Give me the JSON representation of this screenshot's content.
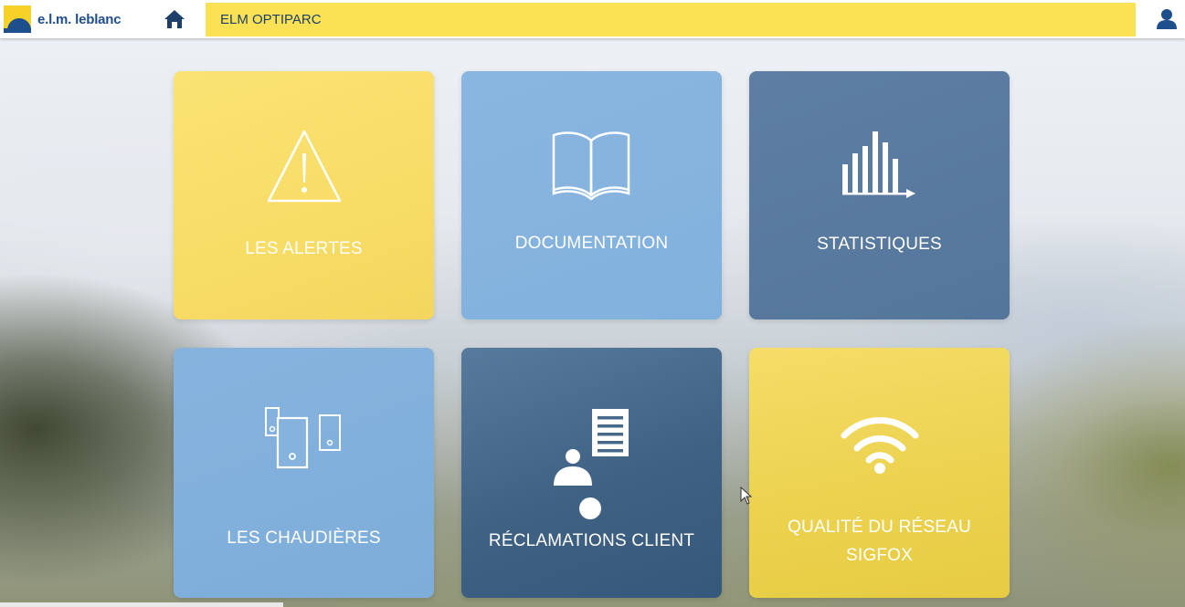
{
  "header": {
    "brand": "e.l.m. leblanc",
    "app_title": "ELM OPTIPARC",
    "home_icon": "home-icon",
    "user_icon": "user-icon"
  },
  "tiles": [
    {
      "label": "LES ALERTES",
      "icon": "warning-triangle-icon",
      "color": "#f7dc66"
    },
    {
      "label": "DOCUMENTATION",
      "icon": "open-book-icon",
      "color": "#84b3de"
    },
    {
      "label": "STATISTIQUES",
      "icon": "bar-chart-icon",
      "color": "#587a9e"
    },
    {
      "label": "LES CHAUDIÈRES",
      "icon": "boilers-icon",
      "color": "#84b3de"
    },
    {
      "label": "RÉCLAMATIONS CLIENT",
      "icon": "client-document-icon",
      "color": "#456889"
    },
    {
      "label_line1": "QUALITÉ DU RÉSEAU",
      "label_line2": "SIGFOX",
      "icon": "wifi-icon",
      "color": "#ecd24f"
    }
  ],
  "colors": {
    "brand_blue": "#1f4e8d",
    "brand_yellow": "#f6d229",
    "app_bar_yellow": "#fbe255"
  }
}
